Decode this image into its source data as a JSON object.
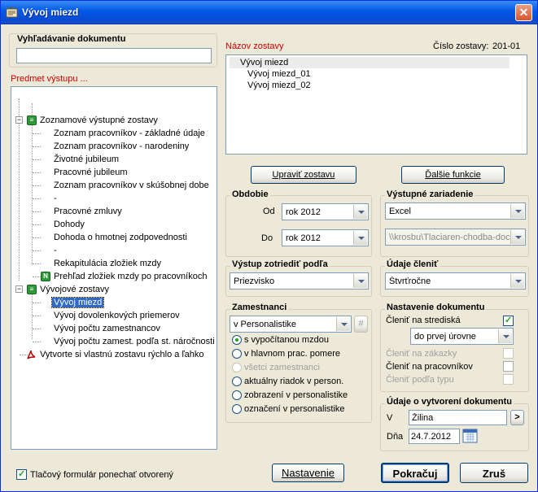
{
  "window": {
    "title": "Vývoj miezd",
    "close_glyph": "✕"
  },
  "search": {
    "label": "Vyhľadávanie dokumentu",
    "value": ""
  },
  "subject": {
    "label": "Predmet výstupu ...",
    "tree": {
      "group1": "Zoznamové výstupné zostavy",
      "group1_items": [
        "Zoznam pracovníkov - základné údaje",
        "Zoznam pracovníkov - narodeniny",
        "Životné jubileum",
        "Pracovné jubileum",
        "Zoznam pracovníkov v skúšobnej dobe",
        "-",
        "Pracovné zmluvy",
        "Dohody",
        "Dohoda o hmotnej zodpovednosti",
        "-",
        "Rekapitulácia zložiek mzdy"
      ],
      "group1_last": "Prehľad zložiek mzdy po pracovníkoch",
      "group2": "Vývojové zostavy",
      "group2_items": [
        "Vývoj miezd",
        "Vývoj dovolenkových priemerov",
        "Vývoj počtu zamestnancov",
        "Vývoj počtu zamest. podľa st. náročnosti"
      ],
      "custom": "Vytvorte si vlastnú zostavu rýchlo a ľahko"
    }
  },
  "report": {
    "name_label": "Názov zostavy",
    "number_label": "Číslo zostavy:",
    "number_value": "201-01",
    "list": [
      "Vývoj miezd",
      "Vývoj miezd_01",
      "Vývoj miezd_02"
    ]
  },
  "buttons": {
    "edit": "Upraviť zostavu",
    "more": "Ďalšie funkcie",
    "settings": "Nastavenie",
    "continue": "Pokračuj",
    "cancel": "Zruš"
  },
  "period": {
    "title": "Obdobie",
    "from_label": "Od",
    "from_value": "rok 2012",
    "to_label": "Do",
    "to_value": "rok 2012"
  },
  "output_device": {
    "title": "Výstupné zariadenie",
    "device": "Excel",
    "printer": "\\\\krosbu\\Tlaciaren-chodba-doc"
  },
  "sort": {
    "title": "Výstup zotriediť podľa",
    "value": "Priezvisko"
  },
  "split": {
    "title": "Údaje členiť",
    "value": "Štvrťročne"
  },
  "employees": {
    "title": "Zamestnanci",
    "source": "v Personalistike",
    "hash_glyph": "#",
    "options": [
      {
        "label": "s vypočítanou mzdou",
        "selected": true,
        "disabled": false
      },
      {
        "label": "v hlavnom prac. pomere",
        "selected": false,
        "disabled": false
      },
      {
        "label": "všetci zamestnanci",
        "selected": false,
        "disabled": true
      },
      {
        "label": "aktuálny riadok v person.",
        "selected": false,
        "disabled": false
      },
      {
        "label": "zobrazení v personalistike",
        "selected": false,
        "disabled": false
      },
      {
        "label": "označení v personalistike",
        "selected": false,
        "disabled": false
      }
    ]
  },
  "doc_settings": {
    "title": "Nastavenie dokumentu",
    "by_center": "Členiť na strediská",
    "level": "do prvej úrovne",
    "by_order": "Členiť na zákazky",
    "by_worker": "Členiť na pracovníkov",
    "by_type": "Členiť podľa typu"
  },
  "creation": {
    "title": "Údaje o vytvorení dokumentu",
    "place_label": "V",
    "place_value": "Žilina",
    "date_label": "Dňa",
    "date_value": "24.7.2012",
    "go_glyph": ">"
  },
  "footer": {
    "keep_form": "Tlačový formulár ponechať otvorený"
  }
}
